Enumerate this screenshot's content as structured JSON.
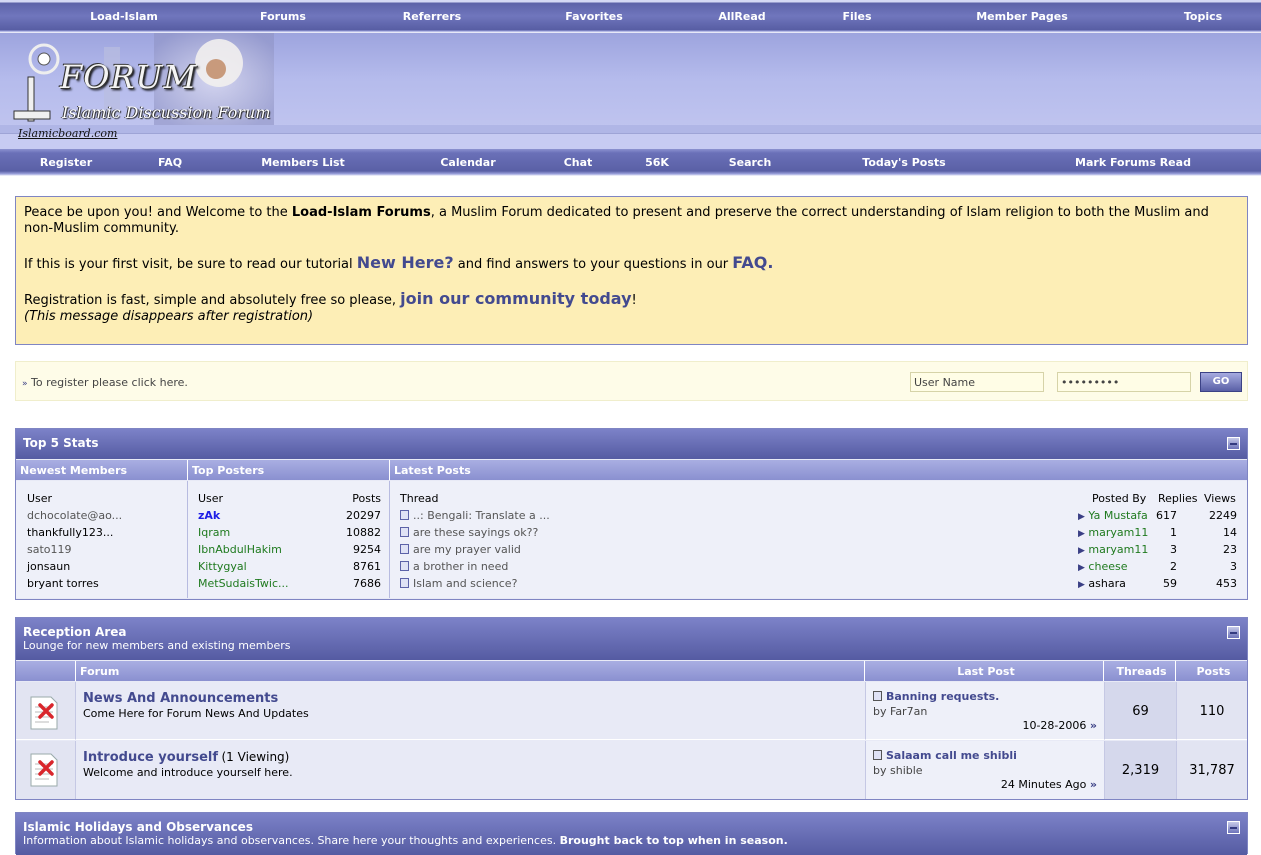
{
  "top_nav": [
    "Load-Islam",
    "Forums",
    "Referrers",
    "Favorites",
    "AllRead",
    "Files",
    "Member Pages",
    "Topics"
  ],
  "logo": {
    "title": "FORUM",
    "subtitle": "Islamic Discussion Forum",
    "url": "Islamicboard.com"
  },
  "sub_nav": [
    "Register",
    "FAQ",
    "Members List",
    "Calendar",
    "Chat",
    "56K",
    "Search",
    "Today's Posts",
    "Mark Forums Read"
  ],
  "welcome": {
    "p1_a": "Peace be upon you! and Welcome to the ",
    "p1_b": "Load-Islam Forums",
    "p1_c": ", a Muslim Forum dedicated to present and preserve the correct understanding of Islam religion to both the Muslim and non-Muslim community.",
    "p2_a": "If this is your first visit, be sure to read our tutorial ",
    "p2_link1": "New Here?",
    "p2_b": " and find answers to your questions in our ",
    "p2_link2": "FAQ.",
    "p3_a": "Registration is fast, simple and absolutely free so please, ",
    "p3_link": "join our community today",
    "p3_b": "!",
    "p3_note": "(This message disappears after registration)"
  },
  "login": {
    "register_text": "To register please click here.",
    "username_value": "User Name",
    "password_value": "•••••••••",
    "go_label": "GO"
  },
  "top5": {
    "title": "Top 5 Stats",
    "col_newest": "Newest Members",
    "col_posters": "Top Posters",
    "col_latest": "Latest Posts",
    "user_label": "User",
    "posts_label": "Posts",
    "thread_label": "Thread",
    "posted_by_label": "Posted By",
    "replies_label": "Replies",
    "views_label": "Views",
    "newest_members": [
      "dchocolate@ao...",
      "thankfully123...",
      "sato119",
      "jonsaun",
      "bryant torres"
    ],
    "top_posters": [
      {
        "user": "zAk",
        "posts": "20297"
      },
      {
        "user": "Iqram",
        "posts": "10882"
      },
      {
        "user": "IbnAbdulHakim",
        "posts": "9254"
      },
      {
        "user": "Kittygyal",
        "posts": "8761"
      },
      {
        "user": "MetSudaisTwic...",
        "posts": "7686"
      }
    ],
    "latest_posts": [
      {
        "thread": "..: Bengali: Translate a ...",
        "by": "Ya Mustafa",
        "replies": "617",
        "views": "2249"
      },
      {
        "thread": "are these sayings ok??",
        "by": "maryam11",
        "replies": "1",
        "views": "14"
      },
      {
        "thread": "are my prayer valid",
        "by": "maryam11",
        "replies": "3",
        "views": "23"
      },
      {
        "thread": "a brother in need",
        "by": "cheese",
        "replies": "2",
        "views": "3"
      },
      {
        "thread": "Islam and science?",
        "by": "ashara",
        "replies": "59",
        "views": "453"
      }
    ]
  },
  "reception": {
    "title": "Reception Area",
    "subtitle": "Lounge for new members and existing members",
    "col_forum": "Forum",
    "col_lastpost": "Last Post",
    "col_threads": "Threads",
    "col_posts": "Posts",
    "forums": [
      {
        "name": "News And Announcements",
        "viewing": "",
        "desc": "Come Here for Forum News And Updates",
        "lp_title": "Banning requests.",
        "lp_by_label": "by",
        "lp_by": "Far7an",
        "lp_date": "10-28-2006",
        "threads": "69",
        "posts": "110"
      },
      {
        "name": "Introduce yourself",
        "viewing": "(1 Viewing)",
        "desc": "Welcome and introduce yourself here.",
        "lp_title": "Salaam call me shibli",
        "lp_by_label": "by",
        "lp_by": "shible",
        "lp_date": "24 Minutes Ago",
        "threads": "2,319",
        "posts": "31,787"
      }
    ]
  },
  "holidays": {
    "title": "Islamic Holidays and Observances",
    "subtitle": "Information about Islamic holidays and observances. Share here your thoughts and experiences. ",
    "subtitle_bold": "Brought back to top when in season."
  }
}
